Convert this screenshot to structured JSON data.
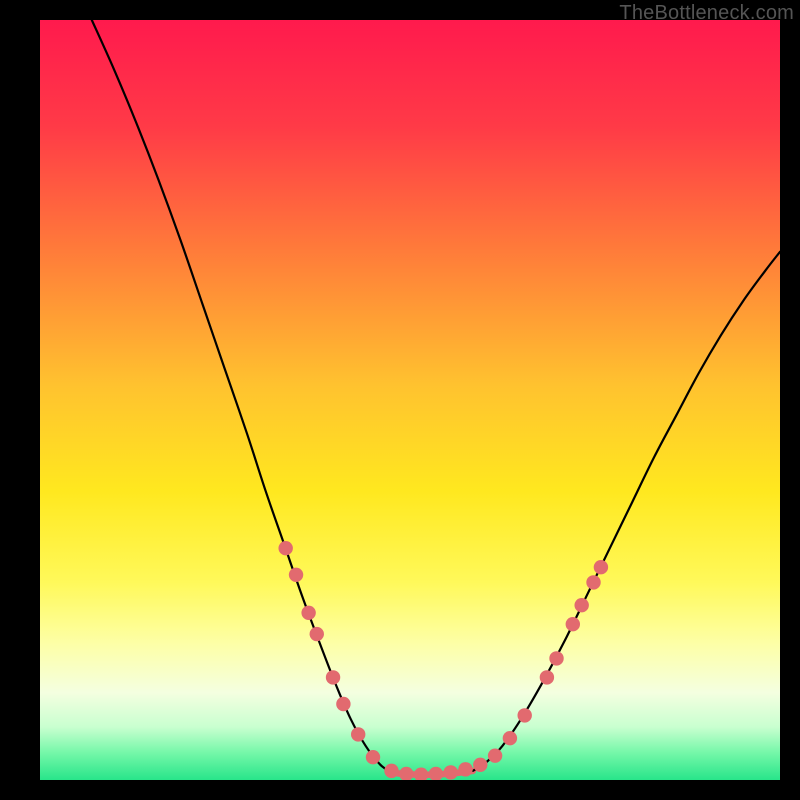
{
  "watermark": "TheBottleneck.com",
  "chart_data": {
    "type": "line",
    "title": "",
    "xlabel": "",
    "ylabel": "",
    "xlim": [
      0,
      100
    ],
    "ylim": [
      0,
      100
    ],
    "background_gradient": {
      "stops": [
        {
          "offset": 0.0,
          "color": "#ff1a4d"
        },
        {
          "offset": 0.14,
          "color": "#ff3a47"
        },
        {
          "offset": 0.3,
          "color": "#ff7a3a"
        },
        {
          "offset": 0.48,
          "color": "#ffc22f"
        },
        {
          "offset": 0.62,
          "color": "#ffe81f"
        },
        {
          "offset": 0.74,
          "color": "#fff95a"
        },
        {
          "offset": 0.82,
          "color": "#fdffa6"
        },
        {
          "offset": 0.885,
          "color": "#f4ffe0"
        },
        {
          "offset": 0.93,
          "color": "#c9ffd0"
        },
        {
          "offset": 0.965,
          "color": "#73f7a8"
        },
        {
          "offset": 1.0,
          "color": "#28e58a"
        }
      ]
    },
    "series": [
      {
        "name": "left-curve",
        "stroke": "#000000",
        "stroke_width": 2.2,
        "points_xy": [
          [
            7.0,
            100.0
          ],
          [
            10.0,
            93.5
          ],
          [
            13.0,
            86.5
          ],
          [
            16.0,
            79.0
          ],
          [
            19.0,
            71.0
          ],
          [
            22.0,
            62.5
          ],
          [
            25.0,
            54.0
          ],
          [
            28.0,
            45.5
          ],
          [
            30.5,
            38.0
          ],
          [
            33.0,
            31.0
          ],
          [
            35.5,
            24.0
          ],
          [
            38.0,
            17.5
          ],
          [
            40.0,
            12.5
          ],
          [
            42.0,
            8.0
          ],
          [
            44.0,
            4.5
          ],
          [
            46.0,
            2.0
          ],
          [
            47.5,
            1.0
          ]
        ]
      },
      {
        "name": "bottom-plateau",
        "stroke": "#e26a6f",
        "stroke_width": 6.5,
        "points_xy": [
          [
            47.5,
            1.0
          ],
          [
            49.0,
            0.8
          ],
          [
            51.0,
            0.7
          ],
          [
            53.0,
            0.7
          ],
          [
            55.0,
            0.8
          ],
          [
            57.0,
            1.0
          ],
          [
            58.5,
            1.2
          ]
        ]
      },
      {
        "name": "right-curve",
        "stroke": "#000000",
        "stroke_width": 2.2,
        "points_xy": [
          [
            58.5,
            1.2
          ],
          [
            60.5,
            2.5
          ],
          [
            62.5,
            4.5
          ],
          [
            65.0,
            8.0
          ],
          [
            68.0,
            13.0
          ],
          [
            71.0,
            18.5
          ],
          [
            74.0,
            24.5
          ],
          [
            77.0,
            30.5
          ],
          [
            80.0,
            36.5
          ],
          [
            83.0,
            42.5
          ],
          [
            86.0,
            48.0
          ],
          [
            89.0,
            53.5
          ],
          [
            92.0,
            58.5
          ],
          [
            95.0,
            63.0
          ],
          [
            98.0,
            67.0
          ],
          [
            100.0,
            69.5
          ]
        ]
      }
    ],
    "markers": {
      "color": "#e26a6f",
      "radius": 7.2,
      "points_xy": [
        [
          33.2,
          30.5
        ],
        [
          34.6,
          27.0
        ],
        [
          36.3,
          22.0
        ],
        [
          37.4,
          19.2
        ],
        [
          39.6,
          13.5
        ],
        [
          41.0,
          10.0
        ],
        [
          43.0,
          6.0
        ],
        [
          45.0,
          3.0
        ],
        [
          47.5,
          1.2
        ],
        [
          49.5,
          0.8
        ],
        [
          51.5,
          0.7
        ],
        [
          53.5,
          0.8
        ],
        [
          55.5,
          1.0
        ],
        [
          57.5,
          1.4
        ],
        [
          59.5,
          2.0
        ],
        [
          61.5,
          3.2
        ],
        [
          63.5,
          5.5
        ],
        [
          65.5,
          8.5
        ],
        [
          68.5,
          13.5
        ],
        [
          69.8,
          16.0
        ],
        [
          72.0,
          20.5
        ],
        [
          73.2,
          23.0
        ],
        [
          74.8,
          26.0
        ],
        [
          75.8,
          28.0
        ]
      ]
    }
  }
}
